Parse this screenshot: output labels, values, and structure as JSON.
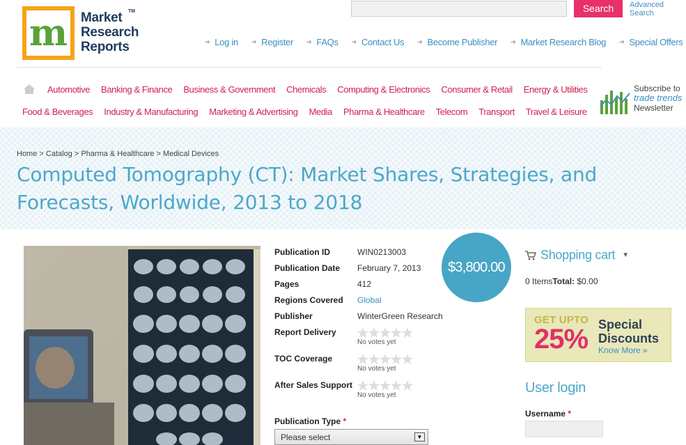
{
  "brand": {
    "logo_letter": "m",
    "name_lines": [
      "Market",
      "Research",
      "Reports"
    ],
    "tm": "TM"
  },
  "search": {
    "button_label": "Search",
    "advanced_label_1": "Advanced",
    "advanced_label_2": "Search",
    "placeholder": ""
  },
  "toplinks": [
    "Log in",
    "Register",
    "FAQs",
    "Contact Us",
    "Become Publisher",
    "Market Research Blog",
    "Special Offers"
  ],
  "categories_row1": [
    "Automotive",
    "Banking & Finance",
    "Business & Government",
    "Chemicals",
    "Computing & Electronics",
    "Consumer & Retail",
    "Energy & Utilities"
  ],
  "categories_row2": [
    "Food & Beverages",
    "Industry & Manufacturing",
    "Marketing & Advertising",
    "Media",
    "Pharma & Healthcare",
    "Telecom",
    "Transport",
    "Travel & Leisure"
  ],
  "newsletter": {
    "line1": "Subscribe to",
    "line2": "trade trends",
    "line3": "Newsletter"
  },
  "breadcrumb": "Home > Catalog > Pharma & Healthcare > Medical Devices",
  "title": "Computed Tomography (CT): Market Shares, Strategies, and Forecasts, Worldwide, 2013 to 2018",
  "details": {
    "publication_id_label": "Publication ID",
    "publication_id": "WIN0213003",
    "publication_date_label": "Publication Date",
    "publication_date": "February 7, 2013",
    "pages_label": "Pages",
    "pages": "412",
    "regions_label": "Regions Covered",
    "regions": "Global",
    "publisher_label": "Publisher",
    "publisher": "WinterGreen Research",
    "report_delivery_label": "Report Delivery",
    "toc_coverage_label": "TOC Coverage",
    "after_sales_label": "After Sales Support",
    "no_votes": "No votes yet"
  },
  "price": "$3,800.00",
  "publication_type": {
    "label": "Publication Type",
    "required": "*",
    "selected": "Please select"
  },
  "cart": {
    "title": "Shopping cart",
    "items": "0 Items",
    "total_label": "Total:",
    "total_value": "$0.00"
  },
  "discount": {
    "get_upto": "GET UPTO",
    "percent": "25%",
    "special": "Special",
    "discounts": "Discounts",
    "know_more": "Know More »"
  },
  "login": {
    "title": "User login",
    "username_label": "Username",
    "required": "*"
  },
  "colors": {
    "accent_blue": "#4ba8c9",
    "accent_pink": "#d0214f",
    "search_pink": "#e8306a",
    "price_circle": "#47a5c6"
  }
}
